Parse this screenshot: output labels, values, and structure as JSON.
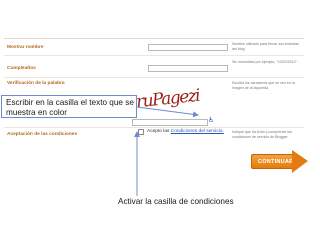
{
  "form": {
    "display_name_label": "Mostrar nombre",
    "display_name_help": "Nombre utilizado para firmar sus entradas del blog",
    "birthday_label": "Cumpleaños",
    "birthday_help": "Sin necesidad por ejemplo, \"10/02/2012\".",
    "word_verification_label": "Verificación de la palabra",
    "word_verification_help": "Escriba los caracteres que se ven en la imagen de la izquierda.",
    "captcha_text": "ruPagezi",
    "wheelchair_icon": "wheelchair-accessibility-icon",
    "terms_label": "Aceptación de las condiciones",
    "terms_help": "Indique que ha leído y comprende las condiciones de servicio de Blogger.",
    "accept_prefix": "Acepto las",
    "accept_link": "Condiciones del servicio.",
    "continue_label": "CONTINUAR"
  },
  "annotations": {
    "captcha_callout": "Escribir en la casilla el texto que se muestra en color",
    "checkbox_callout": "Activar la casilla de condiciones"
  },
  "colors": {
    "label": "#b26a1c",
    "button": "#e37b12",
    "link": "#2a57b5",
    "arrow": "#6d8cc8"
  }
}
